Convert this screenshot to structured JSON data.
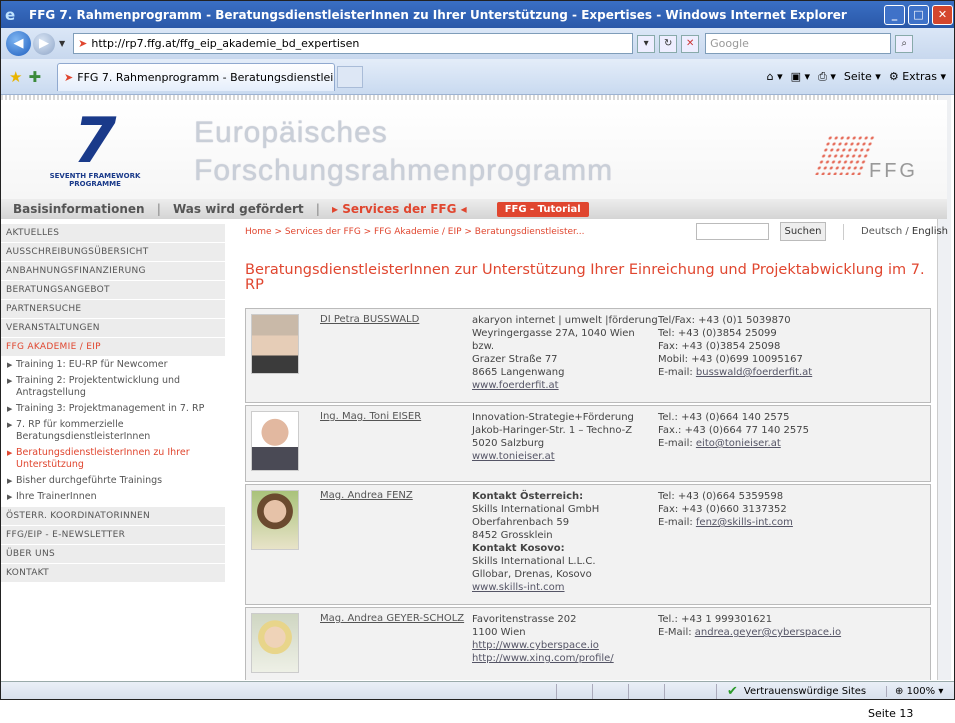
{
  "window": {
    "title": "FFG 7. Rahmenprogramm - BeratungsdienstleisterInnen zu Ihrer Unterstützung - Expertises - Windows Internet Explorer",
    "controls": {
      "minimize": "_",
      "maximize": "□",
      "close": "✕"
    }
  },
  "address": {
    "url": "http://rp7.ffg.at/ffg_eip_akademie_bd_expertisen",
    "search_placeholder": "Google"
  },
  "tab": {
    "label": "FFG 7. Rahmenprogramm - BeratungsdienstleisterInn..."
  },
  "commandbar": {
    "page": "Seite",
    "extras": "Extras"
  },
  "header": {
    "fp7_number": "7",
    "fp7_line1": "SEVENTH FRAMEWORK",
    "fp7_line2": "PROGRAMME",
    "title_line1": "Europäisches",
    "title_line2": "Forschungsrahmenprogramm",
    "ffg": "FFG"
  },
  "mainnav": {
    "items": [
      "Basisinformationen",
      "Was wird gefördert",
      "Services der FFG"
    ],
    "tutorial": "FFG - Tutorial"
  },
  "sidebar": {
    "items_top": [
      "AKTUELLES",
      "AUSSCHREIBUNGSÜBERSICHT",
      "ANBAHNUNGSFINANZIERUNG",
      "BERATUNGSANGEBOT",
      "PARTNERSUCHE",
      "VERANSTALTUNGEN",
      "FFG AKADEMIE / EIP"
    ],
    "subitems": [
      "Training 1: EU-RP für Newcomer",
      "Training 2: Projektentwicklung und Antragstellung",
      "Training 3: Projektmanagement in 7. RP",
      "7. RP für kommerzielle BeratungsdienstleisterInnen",
      "BeratungsdienstleisterInnen zu Ihrer Unterstützung",
      "Bisher durchgeführte Trainings",
      "Ihre TrainerInnen"
    ],
    "items_bottom": [
      "ÖSTERR. KOORDINATORINNEN",
      "FFG/EIP - E-NEWSLETTER",
      "ÜBER UNS",
      "KONTAKT"
    ]
  },
  "breadcrumb": "Home > Services der FFG > FFG Akademie / EIP > Beratungsdienstleister...",
  "search": {
    "button": "Suchen"
  },
  "lang": {
    "de": "Deutsch",
    "sep": " / ",
    "en": "English"
  },
  "page_title": "BeratungsdienstleisterInnen zur Unterstützung Ihrer Einreichung und Projektabwicklung im 7. RP",
  "advisors": [
    {
      "name": "DI Petra BUSSWALD",
      "org": [
        "akaryon internet | umwelt |förderung",
        "Weyringergasse 27A, 1040 Wien bzw.",
        "Grazer Straße 77",
        "8665 Langenwang"
      ],
      "org_link": "www.foerderfit.at",
      "contact": [
        "Tel/Fax: +43 (0)1 5039870",
        "Tel: +43 (0)3854 25099",
        "Fax: +43 (0)3854 25098",
        "Mobil: +43 (0)699 10095167"
      ],
      "email_label": "E-mail: ",
      "email": "busswald@foerderfit.at"
    },
    {
      "name": "Ing. Mag. Toni EISER",
      "org": [
        "Innovation-Strategie+Förderung",
        "Jakob-Haringer-Str. 1 – Techno-Z",
        "5020 Salzburg"
      ],
      "org_link": "www.tonieiser.at",
      "contact": [
        "Tel.: +43 (0)664 140 2575",
        "Fax.: +43 (0)664 77 140 2575"
      ],
      "email_label": "E-mail: ",
      "email": "eito@tonieiser.at"
    },
    {
      "name": "Mag. Andrea FENZ",
      "org_bold1": "Kontakt Österreich:",
      "org": [
        "Skills International GmbH",
        "Oberfahrenbach 59",
        "8452 Grossklein"
      ],
      "org_bold2": "Kontakt Kosovo:",
      "org2": [
        "Skills International L.L.C.",
        "Gllobar, Drenas, Kosovo"
      ],
      "org_link": "www.skills-int.com",
      "contact": [
        "Tel: +43 (0)664 5359598",
        "Fax: +43 (0)660 3137352"
      ],
      "email_label": "E-mail: ",
      "email": "fenz@skills-int.com"
    },
    {
      "name": "Mag. Andrea GEYER-SCHOLZ",
      "org": [
        "Favoritenstrasse 202",
        "1100 Wien"
      ],
      "org_link": "http://www.cyberspace.io",
      "org_link2": "http://www.xing.com/profile/",
      "contact": [
        "Tel.: +43 1 999301621"
      ],
      "email_label": "E-Mail: ",
      "email": "andrea.geyer@cyberspace.io"
    }
  ],
  "statusbar": {
    "trusted": "Vertrauenswürdige Sites",
    "zoom": "100%"
  },
  "page_number": "Seite 13"
}
